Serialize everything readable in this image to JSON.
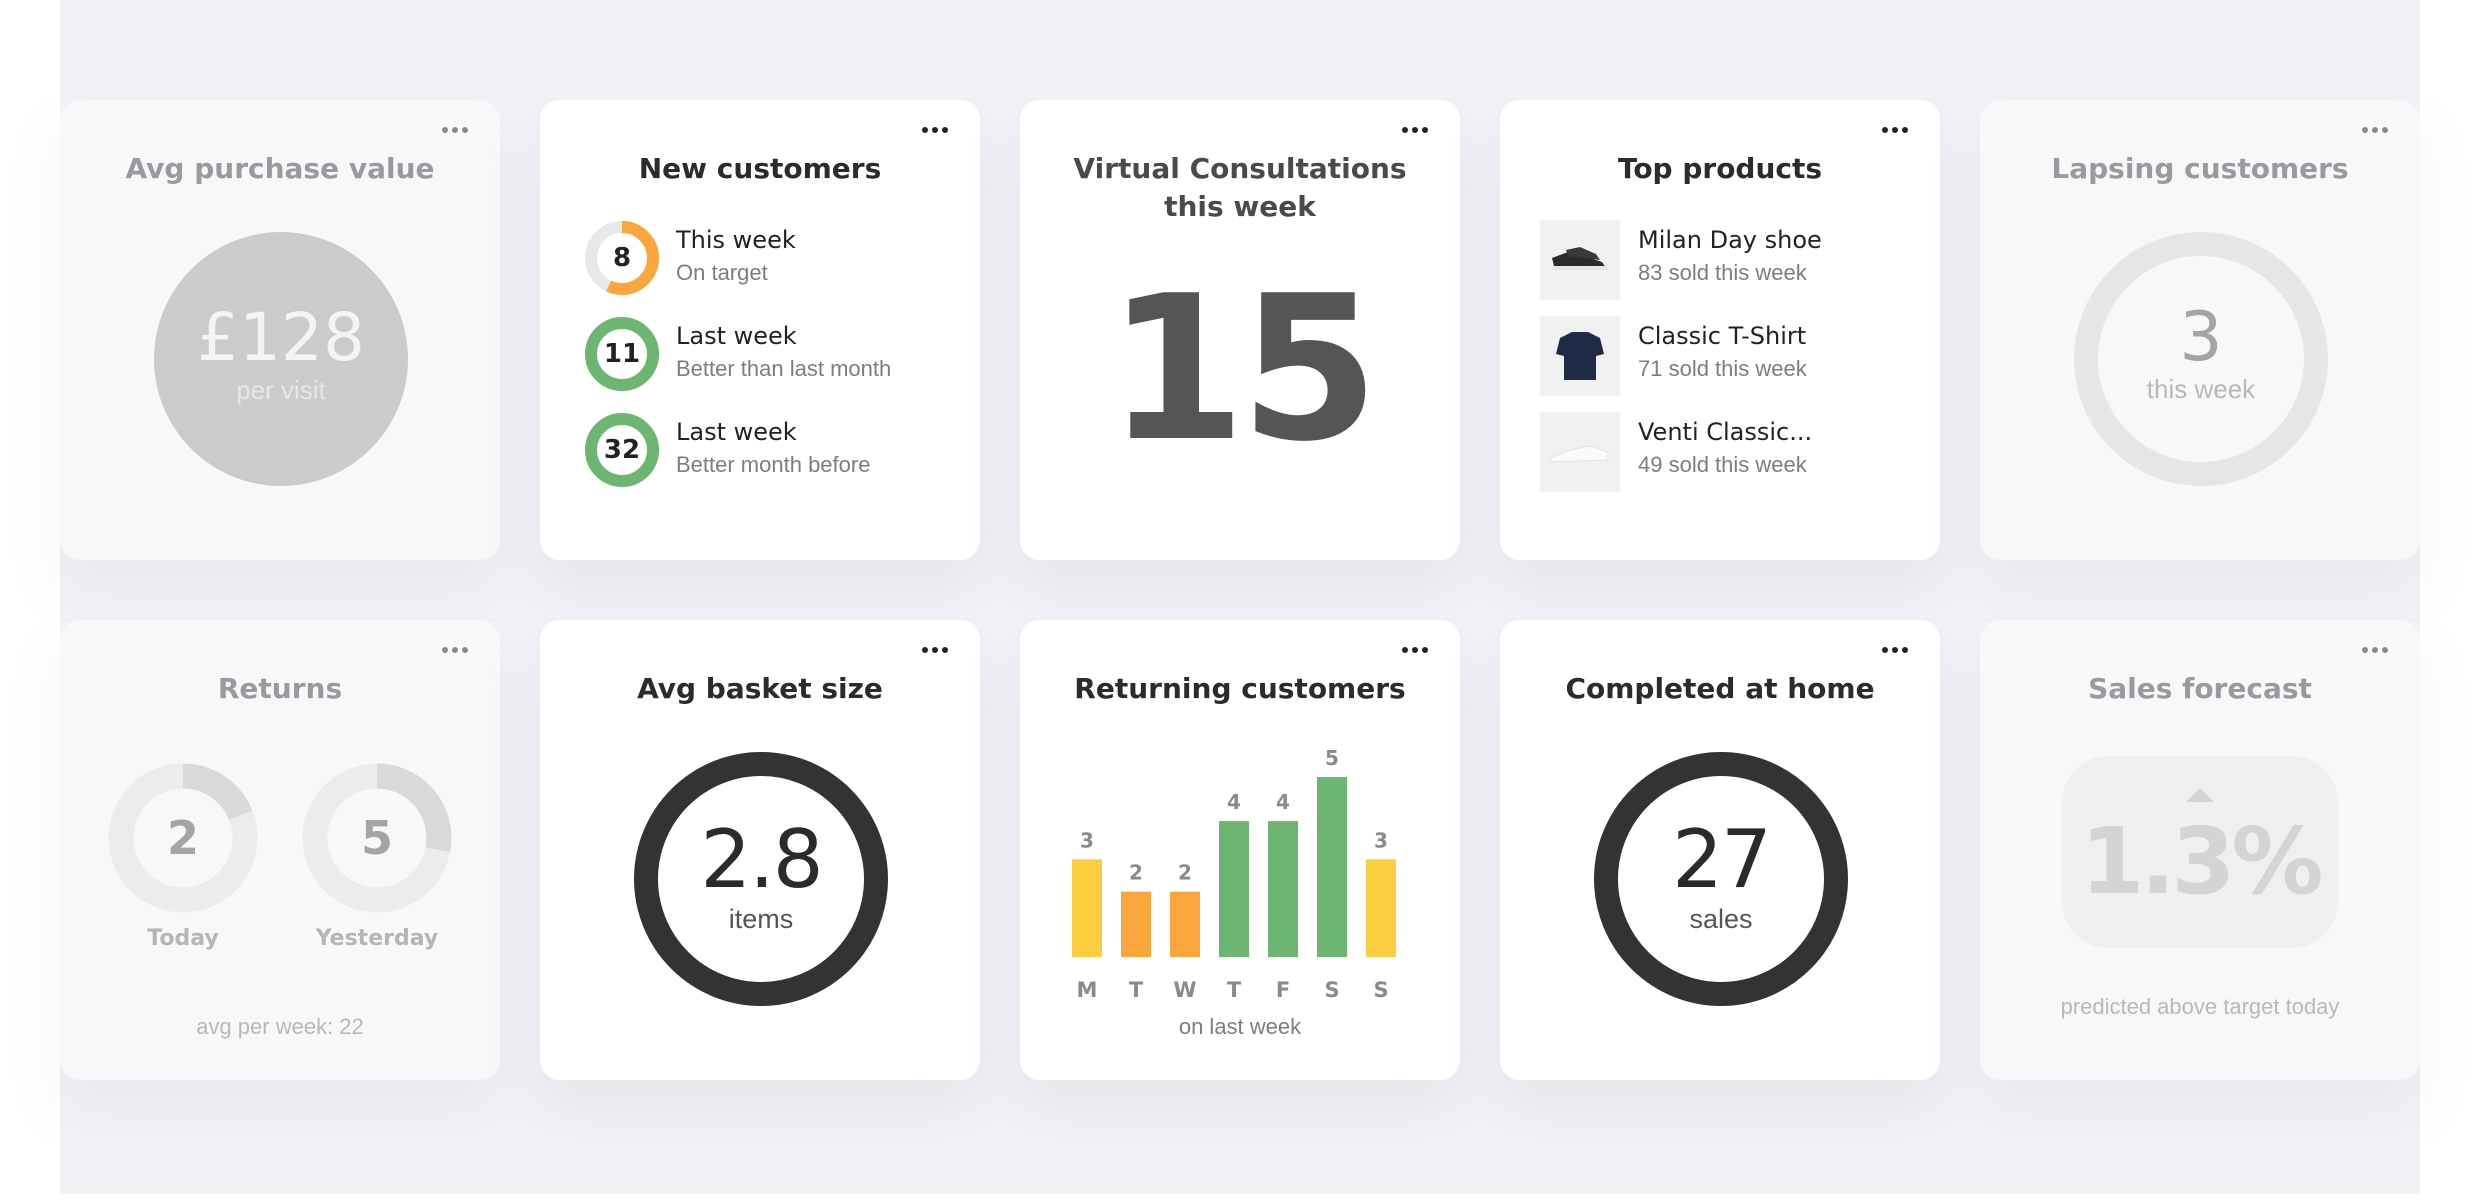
{
  "colors": {
    "accent_orange": "#fba63d",
    "accent_green": "#6db672",
    "accent_yellow": "#fbcd3f",
    "ring_dark": "#333333",
    "panel_bg": "#f2f2f6"
  },
  "menu_icon": "more-horizontal-icon",
  "cards": {
    "avg_purchase": {
      "title": "Avg purchase value",
      "value": "£128",
      "sub": "per visit"
    },
    "new_customers": {
      "title": "New customers",
      "items": [
        {
          "value": "8",
          "label": "This week",
          "sub": "On target",
          "progress": 0.57,
          "color": "#fba63d"
        },
        {
          "value": "11",
          "label": "Last week",
          "sub": "Better than last month",
          "progress": 1.0,
          "color": "#6db672"
        },
        {
          "value": "32",
          "label": "Last week",
          "sub": "Better month before",
          "progress": 1.0,
          "color": "#6db672"
        }
      ]
    },
    "virtual_consultations": {
      "title_line1": "Virtual Consultations",
      "title_line2": "this week",
      "value": "15"
    },
    "top_products": {
      "title": "Top products",
      "items": [
        {
          "name": "Milan Day shoe",
          "sub": "83 sold this week",
          "icon": "black-sneaker-icon"
        },
        {
          "name": "Classic T-Shirt",
          "sub": "71 sold this week",
          "icon": "navy-tshirt-icon"
        },
        {
          "name": "Venti Classic...",
          "sub": "49 sold this week",
          "icon": "white-sneaker-icon"
        }
      ]
    },
    "lapsing_customers": {
      "title": "Lapsing customers",
      "value": "3",
      "sub": "this week"
    },
    "returns": {
      "title": "Returns",
      "today": {
        "value": "2",
        "label": "Today",
        "progress": 0.19
      },
      "yesterday": {
        "value": "5",
        "label": "Yesterday",
        "progress": 0.28
      },
      "footer": "avg per week: 22"
    },
    "avg_basket": {
      "title": "Avg basket size",
      "value": "2.8",
      "sub": "items"
    },
    "returning_customers": {
      "title": "Returning customers",
      "footer": "on last week"
    },
    "completed_home": {
      "title": "Completed at home",
      "value": "27",
      "sub": "sales"
    },
    "sales_forecast": {
      "title": "Sales forecast",
      "value": "1.3%",
      "trend": "up",
      "footer": "predicted above target today"
    }
  },
  "chart_data": {
    "type": "bar",
    "title": "Returning customers",
    "categories": [
      "M",
      "T",
      "W",
      "T",
      "F",
      "S",
      "S"
    ],
    "values": [
      3,
      2,
      2,
      4,
      4,
      5,
      3
    ],
    "colors": [
      "#fbcd3f",
      "#fba63d",
      "#fba63d",
      "#6db672",
      "#6db672",
      "#6db672",
      "#fbcd3f"
    ],
    "data_labels": true,
    "xlabel": "",
    "ylabel": "",
    "footer": "on last week",
    "grid": false
  }
}
